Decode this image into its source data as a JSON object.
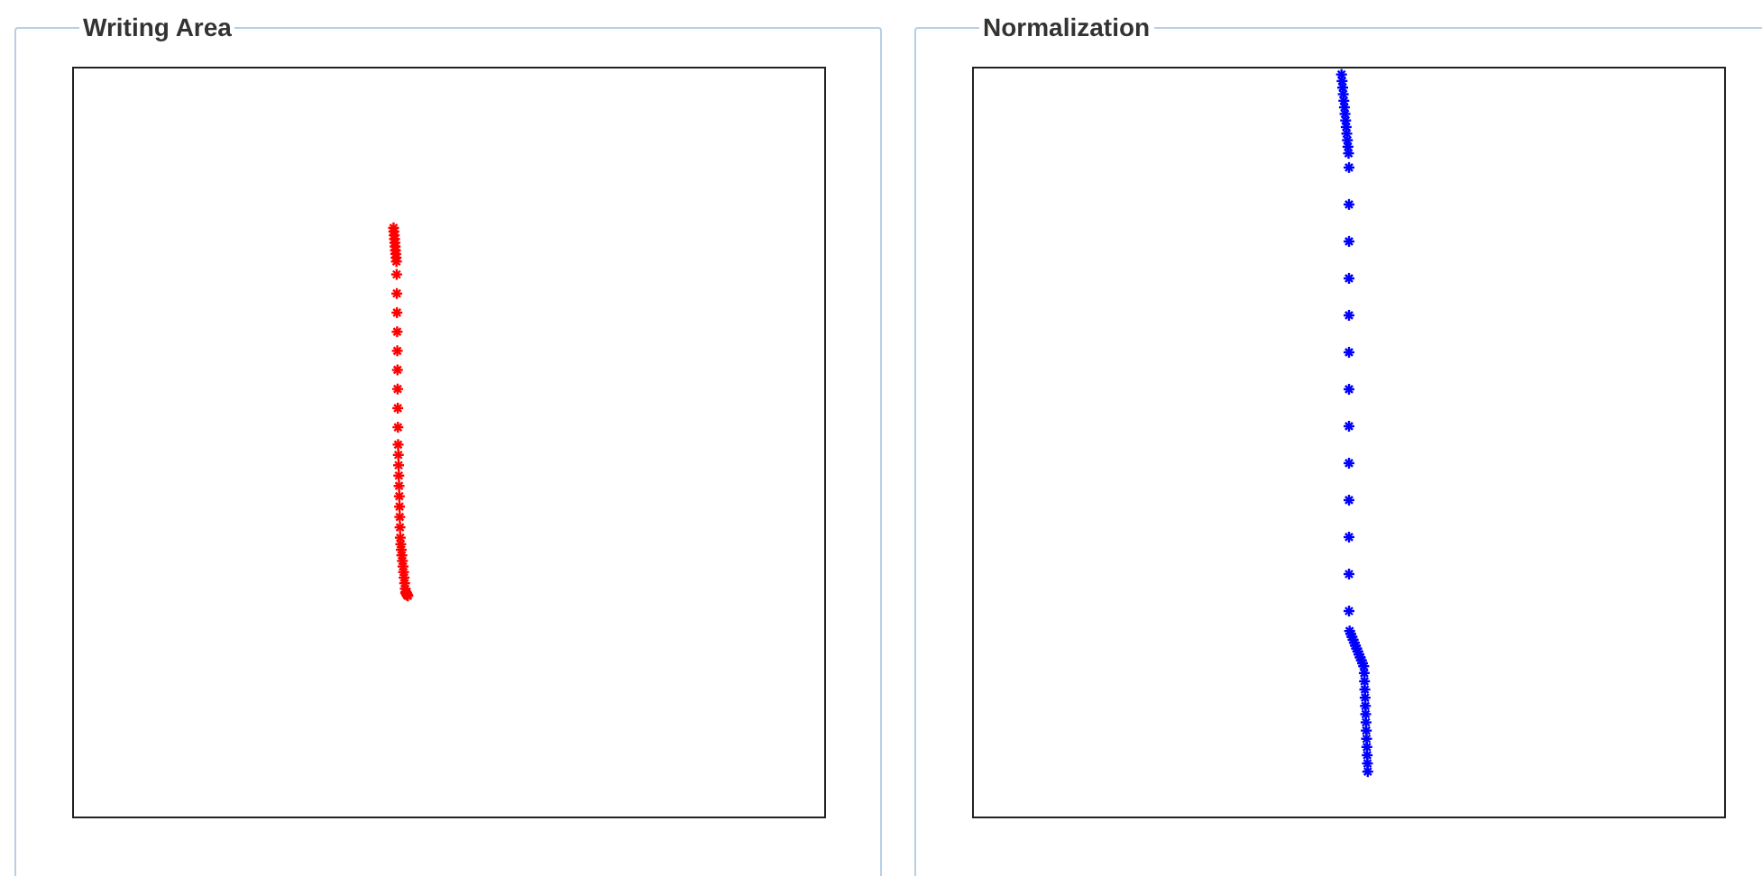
{
  "panels": [
    {
      "title": "Writing Area",
      "color": "#ff0000"
    },
    {
      "title": "Normalization",
      "color": "#0000ff"
    }
  ]
}
